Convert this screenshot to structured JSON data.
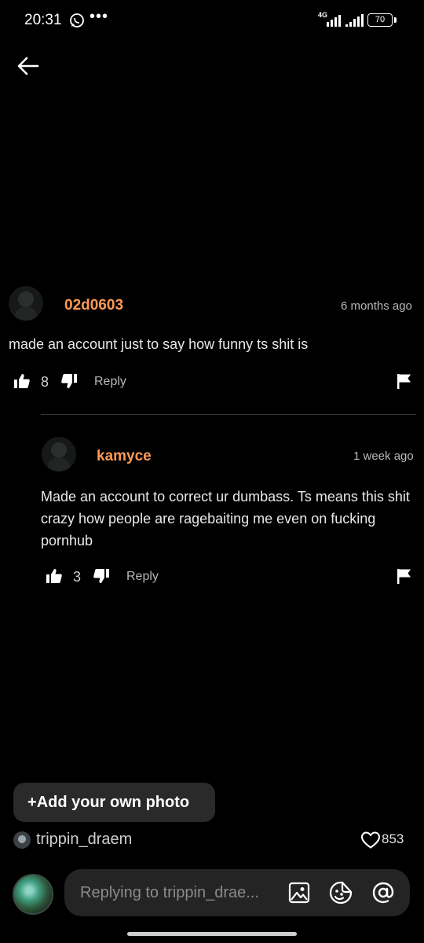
{
  "status_bar": {
    "time": "20:31",
    "dots": "•••",
    "network": "4G",
    "battery": "70"
  },
  "comments": [
    {
      "username": "02d0603",
      "time": "6 months ago",
      "text": "made an account just to say how funny ts shit is",
      "likes": "8",
      "reply_label": "Reply"
    },
    {
      "username": "kamyce",
      "time": "1 week ago",
      "text": "Made an account to correct ur dumbass. Ts means this shit crazy how people are ragebaiting me even on fucking pornhub",
      "likes": "3",
      "reply_label": "Reply"
    }
  ],
  "add_photo": {
    "plus": "+",
    "label": "Add your own photo"
  },
  "post": {
    "author": "trippin_draem",
    "likes": "853"
  },
  "composer": {
    "placeholder": "Replying to trippin_drae..."
  },
  "colors": {
    "username": "#ff9a55",
    "background": "#000000",
    "input_bg": "#242424"
  }
}
